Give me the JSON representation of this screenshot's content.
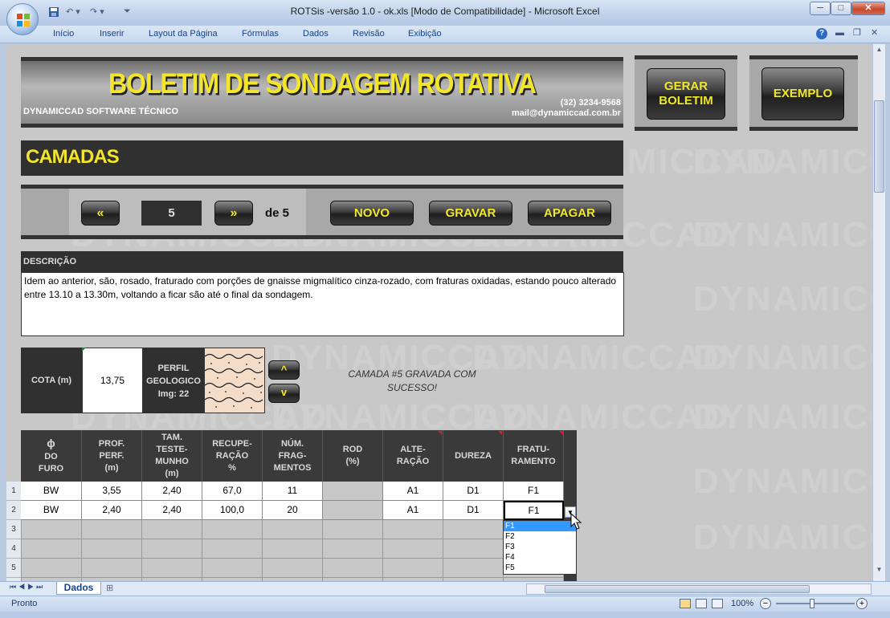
{
  "window": {
    "title": "ROTSis -versão 1.0 - ok.xls  [Modo de Compatibilidade] - Microsoft Excel",
    "min_label": "─",
    "max_label": "□",
    "close_label": "✕"
  },
  "ribbon": {
    "tabs": [
      "Início",
      "Inserir",
      "Layout da Página",
      "Fórmulas",
      "Dados",
      "Revisão",
      "Exibição"
    ],
    "help_label": "?"
  },
  "header": {
    "title": "BOLETIM DE SONDAGEM  ROTATIVA",
    "company": "DYNAMICCAD SOFTWARE TÉCNICO",
    "phone": "(32) 3234-9568",
    "email": "mail@dynamiccad.com.br",
    "gerar_label_1": "GERAR",
    "gerar_label_2": "BOLETIM",
    "exemplo_label": "EXEMPLO"
  },
  "section": {
    "title": "CAMADAS"
  },
  "nav": {
    "prev_label": "«",
    "current": "5",
    "next_label": "»",
    "total_label": "de 5",
    "novo_label": "NOVO",
    "gravar_label": "GRAVAR",
    "apagar_label": "APAGAR"
  },
  "descricao": {
    "label": "DESCRIÇÃO",
    "text": "Idem ao anterior, são, rosado, fraturado com porções de gnaisse migmalítico cinza-rozado, com fraturas oxidadas, estando pouco alterado entre 13.10 a 13.30m, voltando a ficar são até o final da sondagem."
  },
  "cota": {
    "label": "COTA (m)",
    "value": "13,75"
  },
  "perfil": {
    "label_1": "PERFIL",
    "label_2": "GEOLOGICO",
    "img_label": "Img: 22",
    "up_label": "^",
    "down_label": "v"
  },
  "status_message": {
    "line1": "CAMADA #5 GRAVADA COM",
    "line2": "SUCESSO!"
  },
  "watermark": "DYNAMICCAD",
  "table": {
    "headers": [
      [
        "ϕ",
        "DO",
        "FURO"
      ],
      [
        "PROF.",
        "PERF.",
        "(m)"
      ],
      [
        "TAM.",
        "TESTE-",
        "MUNHO",
        "(m)"
      ],
      [
        "RECUPE-",
        "RAÇÃO",
        "%"
      ],
      [
        "NÚM.",
        "FRAG-",
        "MENTOS"
      ],
      [
        "ROD",
        "(%)"
      ],
      [
        "ALTE-",
        "RAÇÃO"
      ],
      [
        "DUREZA"
      ],
      [
        "FRATU-",
        "RAMENTO"
      ]
    ],
    "row_numbers": [
      "1",
      "2",
      "3",
      "4",
      "5"
    ],
    "rows": [
      [
        "BW",
        "3,55",
        "2,40",
        "67,0",
        "11",
        "",
        "A1",
        "D1",
        "F1"
      ],
      [
        "BW",
        "2,40",
        "2,40",
        "100,0",
        "20",
        "",
        "A1",
        "D1",
        "F1"
      ]
    ],
    "dropdown_options": [
      "F1",
      "F2",
      "F3",
      "F4",
      "F5"
    ],
    "dropdown_selected": "F1"
  },
  "sheet_tabs": {
    "active": "Dados"
  },
  "statusbar": {
    "ready": "Pronto",
    "zoom": "100%",
    "zoom_out": "−",
    "zoom_in": "+"
  }
}
